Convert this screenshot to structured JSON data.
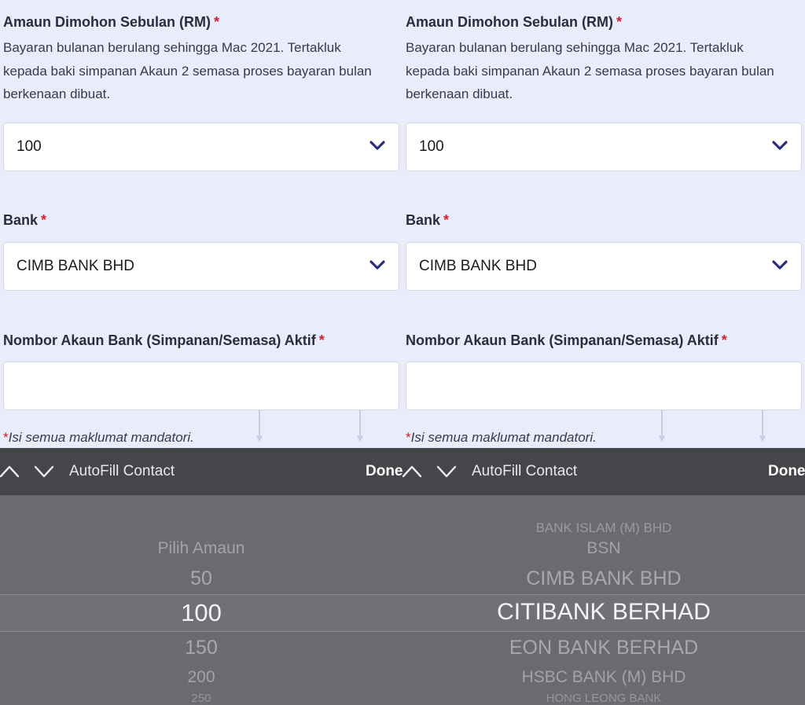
{
  "panes": [
    {
      "amount_label": "Amaun Dimohon Sebulan (RM)",
      "amount_desc": "Bayaran bulanan berulang sehingga Mac 2021. Tertakluk kepada baki simpanan Akaun 2 semasa proses bayaran bulan berkenaan dibuat.",
      "amount_value": "100",
      "bank_label": "Bank",
      "bank_value": "CIMB BANK BHD",
      "account_label": "Nombor Akaun Bank (Simpanan/Semasa) Aktif",
      "account_value": "",
      "required_mark": "*",
      "mandatory_note": "Isi semua maklumat mandatori.",
      "toolbar": {
        "title": "AutoFill Contact",
        "done": "Done"
      },
      "picker": {
        "items": [
          "Pilih Amaun",
          "50",
          "100",
          "150",
          "200",
          "250"
        ],
        "selected": "100"
      }
    },
    {
      "amount_label": "Amaun Dimohon Sebulan (RM)",
      "amount_desc": "Bayaran bulanan berulang sehingga Mac 2021. Tertakluk kepada baki simpanan Akaun 2 semasa proses bayaran bulan berkenaan dibuat.",
      "amount_value": "100",
      "bank_label": "Bank",
      "bank_value": "CIMB BANK BHD",
      "account_label": "Nombor Akaun Bank (Simpanan/Semasa) Aktif",
      "account_value": "",
      "required_mark": "*",
      "mandatory_note": "Isi semua maklumat mandatori.",
      "toolbar": {
        "title": "AutoFill Contact",
        "done": "Done"
      },
      "picker": {
        "items": [
          "BANK ISLAM (M) BHD",
          "BSN",
          "CIMB BANK BHD",
          "CITIBANK BERHAD",
          "EON BANK BERHAD",
          "HSBC BANK (M) BHD",
          "HONG LEONG BANK"
        ],
        "selected": "CITIBANK BERHAD"
      }
    }
  ],
  "colors": {
    "accent": "#2b2d82",
    "required": "#d0212b",
    "form_bg": "#e9ecfb",
    "toolbar_bg": "#45464a",
    "picker_bg": "#6a6b71"
  }
}
